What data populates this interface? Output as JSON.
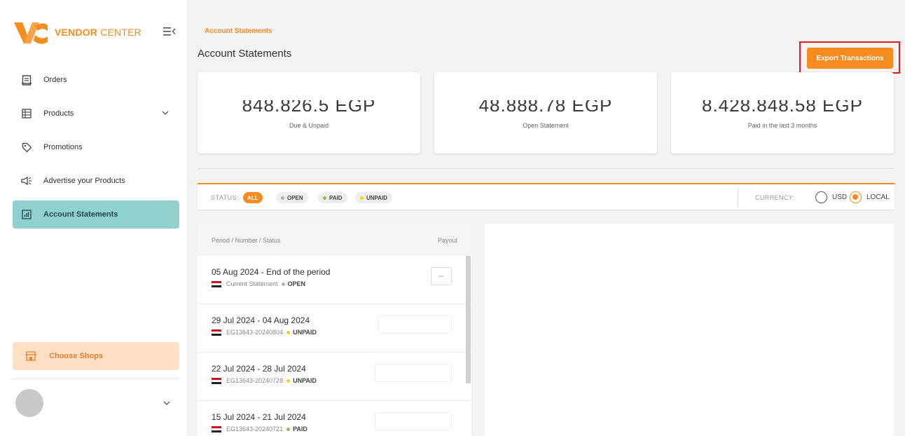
{
  "brand": {
    "name_bold": "VENDOR",
    "name_thin": " CENTER",
    "accent": "#f68b1e"
  },
  "sidebar": {
    "items": [
      {
        "label": "Orders",
        "icon": "orders-icon"
      },
      {
        "label": "Products",
        "icon": "products-icon",
        "expandable": true
      },
      {
        "label": "Promotions",
        "icon": "tag-icon"
      },
      {
        "label": "Advertise your Products",
        "icon": "megaphone-icon"
      },
      {
        "label": "Account Statements",
        "icon": "chart-icon",
        "active": true
      }
    ],
    "choose_shops": "Choose Shops"
  },
  "header": {
    "breadcrumb": "Account Statements",
    "title": "Account Statements",
    "export_label": "Export Transactions"
  },
  "summary": [
    {
      "value": "848,826.5 EGP",
      "caption": "Due & Unpaid"
    },
    {
      "value": "48,888.78 EGP",
      "caption": "Open Statement"
    },
    {
      "value": "8,428,848.58 EGP",
      "caption": "Paid in the last 3 months"
    }
  ],
  "filters": {
    "status_label": "STATUS:",
    "chips": [
      {
        "label": "ALL",
        "active": true
      },
      {
        "label": "OPEN",
        "dot": "#b0b0b0"
      },
      {
        "label": "PAID",
        "dot": "#8bc34a"
      },
      {
        "label": "UNPAID",
        "dot": "#f5d400"
      }
    ],
    "currency_label": "CURRENCY:",
    "currency_options": [
      "USD",
      "LOCAL"
    ],
    "currency_selected": "LOCAL"
  },
  "statements": {
    "headers": {
      "period": "Period / Number / Status",
      "payout": "Payout"
    },
    "rows": [
      {
        "period": "05 Aug 2024 - End of the period",
        "number": "Current Statement",
        "status": "OPEN",
        "status_color": "#b0b0b0",
        "payout": "--"
      },
      {
        "period": "29 Jul 2024 - 04 Aug 2024",
        "number": "EG13643-20240804",
        "status": "UNPAID",
        "status_color": "#f5d400",
        "payout": ""
      },
      {
        "period": "22 Jul 2024 - 28 Jul 2024",
        "number": "EG13643-20240728",
        "status": "UNPAID",
        "status_color": "#f5d400",
        "payout": ""
      },
      {
        "period": "15 Jul 2024 - 21 Jul 2024",
        "number": "EG13643-20240721",
        "status": "PAID",
        "status_color": "#8bc34a",
        "payout": ""
      }
    ]
  }
}
